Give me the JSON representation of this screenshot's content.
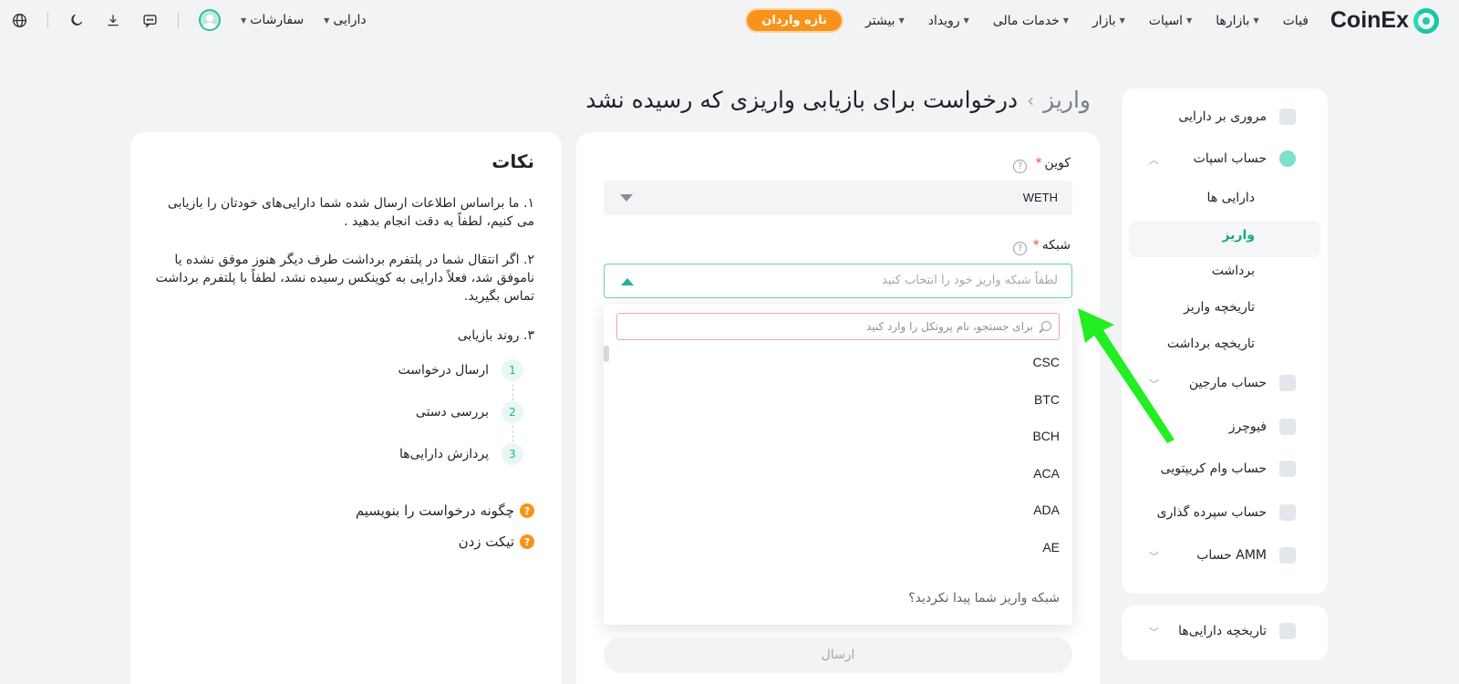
{
  "nav": {
    "brand": "CoinEx",
    "items": [
      {
        "label": "فیات",
        "caret": false
      },
      {
        "label": "بازارها",
        "caret": true
      },
      {
        "label": "اسپات",
        "caret": true
      },
      {
        "label": "بازار",
        "caret": true
      },
      {
        "label": "خدمات مالی",
        "caret": true
      },
      {
        "label": "رویداد",
        "caret": true
      },
      {
        "label": "بیشتر",
        "caret": true
      }
    ],
    "newbie_label": "تازه واردان",
    "assets_label": "دارایی",
    "orders_label": "سفارشات"
  },
  "breadcrumb": {
    "home": "واریز",
    "current": "درخواست برای بازیابی واریزی که رسیده نشد"
  },
  "sidebar": {
    "items": [
      {
        "label": "مروری بر دارایی"
      },
      {
        "label": "حساب اسپات"
      },
      {
        "label": "دارایی ها"
      },
      {
        "label": "واریز",
        "active": true
      },
      {
        "label": "برداشت"
      },
      {
        "label": "تاریخچه واریز"
      },
      {
        "label": "تاریخچه برداشت"
      },
      {
        "label": "حساب مارجین"
      },
      {
        "label": "فیوچرز"
      },
      {
        "label": "حساب وام کریپتویی"
      },
      {
        "label": "حساب سپرده گذاری"
      },
      {
        "label": "حساب AMM"
      }
    ],
    "history_label": "تاریخچه دارایی‌ها"
  },
  "form": {
    "coin_label": "کوین",
    "coin_value": "WETH",
    "network_label": "شبکه",
    "network_placeholder": "لطفاً شبکه واریز خود را انتخاب کنید",
    "search_placeholder": "برای جستجو، نام پروتکل را وارد کنید",
    "network_options": [
      "CSC",
      "BTC",
      "BCH",
      "ACA",
      "ADA",
      "AE"
    ],
    "not_found": "شبکه واریز شما پیدا نکردید؟",
    "submit_label": "ارسال",
    "required_mark": "*",
    "help_mark": "?"
  },
  "notes": {
    "title": "نکات",
    "p1": "۱. ما براساس اطلاعات ارسال شده شما دارایی‌های خودتان را بازیابی می کنیم، لطفاً به دقت انجام بدهید .",
    "p2": "۲. اگر انتقال شما در پلتفرم برداشت طرف دیگر هنوز موفق نشده یا ناموفق شد، فعلاً دارایی به کوینکس رسیده نشد، لطفاً با پلتفرم برداشت تماس بگیرید.",
    "p3": "۳. روند بازیابی",
    "steps": [
      {
        "num": "1",
        "label": "ارسال درخواست"
      },
      {
        "num": "2",
        "label": "بررسی دستی"
      },
      {
        "num": "3",
        "label": "پردازش دارایی‌ها"
      }
    ],
    "link_how": "چگونه درخواست را بنویسیم",
    "link_ticket": "تیکت زدن",
    "q_mark": "?"
  },
  "colors": {
    "accent": "#1fb597",
    "newbie": "#f7931a",
    "arrow": "#22ee22"
  }
}
